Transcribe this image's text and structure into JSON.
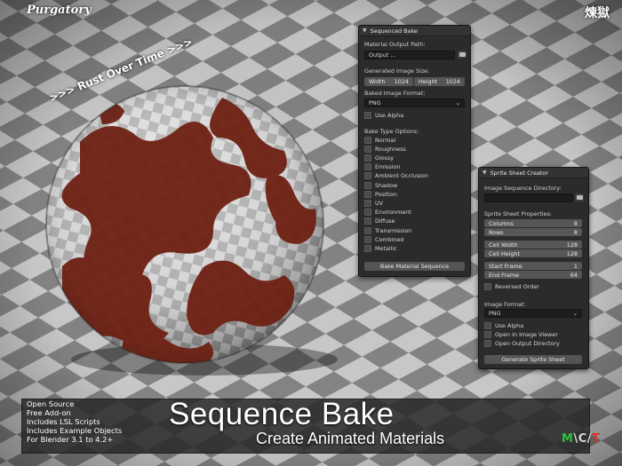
{
  "brand": "Purgatory",
  "kanji": "煉獄",
  "rust_over_time": ">>> Rust Over Time >>>",
  "sequenced_bake": {
    "title": "Sequenced Bake",
    "material_output_path_label": "Material Output Path:",
    "output_value": "Output ...",
    "image_size_label": "Generated Image Size:",
    "width_label": "Width",
    "width_value": "1024",
    "height_label": "Height",
    "height_value": "1024",
    "format_label": "Baked Image Format:",
    "format_value": "PNG",
    "use_alpha": "Use Alpha",
    "bake_type_label": "Bake Type Options:",
    "bake_types": [
      "Normal",
      "Roughness",
      "Glossy",
      "Emission",
      "Ambient Occlusion",
      "Shadow",
      "Position",
      "UV",
      "Environment",
      "Diffuse",
      "Transmission",
      "Combined",
      "Metallic"
    ],
    "bake_button": "Bake Material Sequence"
  },
  "sprite_sheet": {
    "title": "Sprite Sheet Creator",
    "image_dir_label": "Image Sequence Directory:",
    "properties_label": "Sprite Sheet Properties:",
    "columns_label": "Columns",
    "columns_value": "8",
    "rows_label": "Rows",
    "rows_value": "8",
    "cell_width_label": "Cell Width",
    "cell_width_value": "128",
    "cell_height_label": "Cell Height",
    "cell_height_value": "128",
    "start_frame_label": "Start Frame",
    "start_frame_value": "1",
    "end_frame_label": "End Frame",
    "end_frame_value": "64",
    "reversed_order": "Reversed Order",
    "format_label": "Image Format:",
    "format_value": "PNG",
    "use_alpha": "Use Alpha",
    "open_in_viewer": "Open In Image Viewer",
    "open_output_dir": "Open Output Directory",
    "generate_button": "Generate Sprite Sheet"
  },
  "features": [
    "Open Source",
    "Free Add-on",
    "Includes LSL Scripts",
    "Includes Example Objects",
    "For Blender 3.1 to 4.2+"
  ],
  "product_title": "Sequence Bake",
  "product_subtitle": "Create Animated Materials",
  "logo": {
    "m": "M",
    "slash": "\\",
    "c": "C",
    "slash2": "/",
    "t": "T"
  },
  "colors": {
    "panel_bg": "#2b2b2b",
    "rust": "#7a2416",
    "logo_green": "#2fbf3a",
    "logo_red": "#e0302a"
  }
}
